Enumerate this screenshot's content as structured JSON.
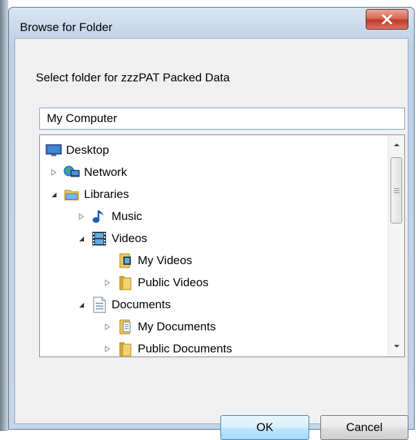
{
  "dialog": {
    "title": "Browse for Folder",
    "description": "Select folder  for zzzPAT Packed Data",
    "path_value": "My Computer",
    "ok_label": "OK",
    "cancel_label": "Cancel"
  },
  "tree": {
    "items": [
      {
        "label": "Desktop",
        "expander": "none",
        "icon": "desktop-icon"
      },
      {
        "label": "Network",
        "expander": "collapsed",
        "icon": "network-icon"
      },
      {
        "label": "Libraries",
        "expander": "expanded",
        "icon": "libraries-icon"
      },
      {
        "label": "Music",
        "expander": "collapsed",
        "icon": "music-icon"
      },
      {
        "label": "Videos",
        "expander": "expanded",
        "icon": "videos-icon"
      },
      {
        "label": "My Videos",
        "expander": "none",
        "icon": "folder-videos-icon"
      },
      {
        "label": "Public Videos",
        "expander": "collapsed",
        "icon": "folder-icon"
      },
      {
        "label": "Documents",
        "expander": "expanded",
        "icon": "documents-icon"
      },
      {
        "label": "My Documents",
        "expander": "collapsed",
        "icon": "folder-documents-icon"
      },
      {
        "label": "Public Documents",
        "expander": "collapsed",
        "icon": "folder-icon"
      }
    ]
  },
  "colors": {
    "close_button": "#c0392b",
    "selection_border": "#7da2ce",
    "ok_border": "#3c7fb1"
  }
}
